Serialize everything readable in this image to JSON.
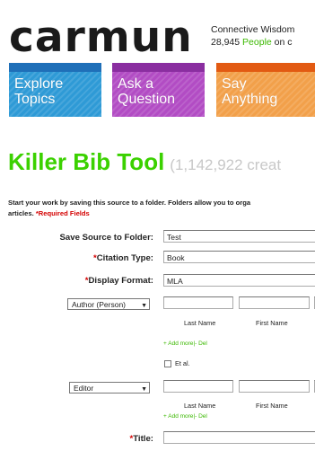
{
  "header": {
    "logo": "carmun",
    "tagline_1": "Connective Wisdom",
    "tagline_2_count": "28,945",
    "tagline_2_green": "People",
    "tagline_2_rest": "on c"
  },
  "nav": [
    {
      "line1": "Explore",
      "line2": "Topics",
      "color": "#2e9ad6",
      "bar": "#1f6fb8"
    },
    {
      "line1": "Ask a",
      "line2": "Question",
      "color": "#b24cc4",
      "bar": "#8a2ea0"
    },
    {
      "line1": "Say",
      "line2": "Anything",
      "color": "#f2a04a",
      "bar": "#e25a12"
    }
  ],
  "page": {
    "title": "Killer Bib Tool",
    "count": "(1,142,922 creat",
    "intro_line1": "Start your work by saving this source to a folder. Folders allow you to orga",
    "intro_line2": "articles.",
    "required_note": "*Required Fields"
  },
  "form": {
    "folder_label": "Save Source to Folder:",
    "folder_value": "Test",
    "citation_label": "Citation Type:",
    "citation_value": "Book",
    "display_label": "Display Format:",
    "display_value": "MLA",
    "contributor_1": "Author (Person)",
    "contributor_2": "Editor",
    "last_name": "Last Name",
    "first_name": "First Name",
    "add_more": "+ Add more",
    "sep": "|",
    "del": "- Del",
    "et_al": "Et al.",
    "title_label": "Title:",
    "star": "*",
    "arrow": "▼"
  }
}
